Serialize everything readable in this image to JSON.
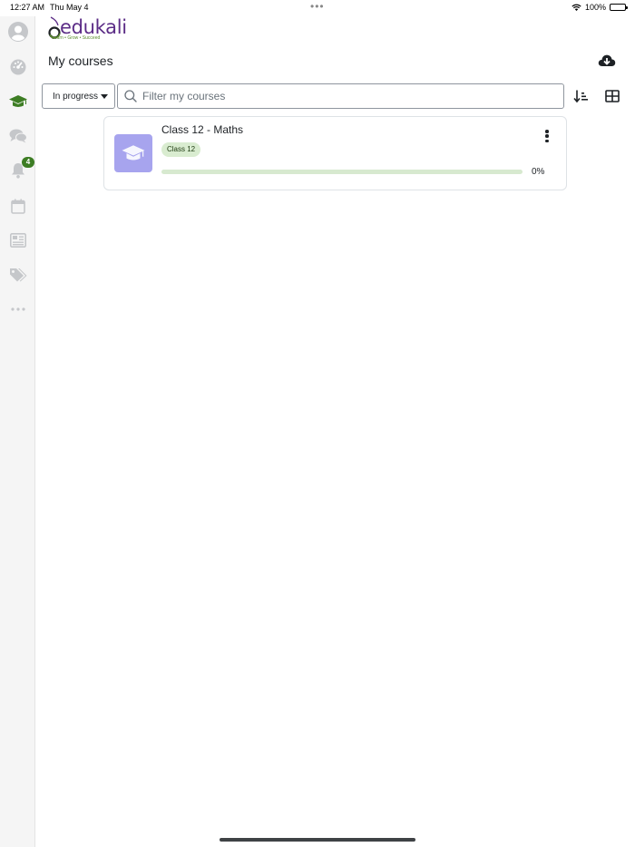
{
  "status_bar": {
    "time": "12:27 AM",
    "date": "Thu May 4",
    "battery": "100%"
  },
  "sidebar": {
    "items": [
      {
        "name": "user-avatar",
        "icon": "user-avatar-icon"
      },
      {
        "name": "dashboard",
        "icon": "dashboard-icon"
      },
      {
        "name": "my-courses",
        "icon": "graduation-cap-icon",
        "active": true
      },
      {
        "name": "messages",
        "icon": "chat-bubbles-icon"
      },
      {
        "name": "notifications",
        "icon": "bell-icon",
        "badge": "4"
      },
      {
        "name": "calendar",
        "icon": "calendar-icon"
      },
      {
        "name": "grades",
        "icon": "gradebook-icon"
      },
      {
        "name": "tags",
        "icon": "tags-icon"
      },
      {
        "name": "more",
        "icon": "more-horizontal-icon"
      }
    ],
    "active_color": "#3d7d24",
    "inactive_color": "#c5c7ca"
  },
  "header": {
    "logo_text": "edukali",
    "logo_tagline": "Learn • Grow • Succeed",
    "page_title": "My courses"
  },
  "filters": {
    "status_selected": "In progress",
    "search_placeholder": "Filter my courses",
    "search_value": ""
  },
  "courses": [
    {
      "title": "Class 12 - Maths",
      "category": "Class 12",
      "progress": 0,
      "progress_label": "0%",
      "thumb_color": "#a7a4ee"
    }
  ],
  "colors": {
    "brand_purple": "#5b2c86",
    "brand_green": "#3d7d24"
  }
}
